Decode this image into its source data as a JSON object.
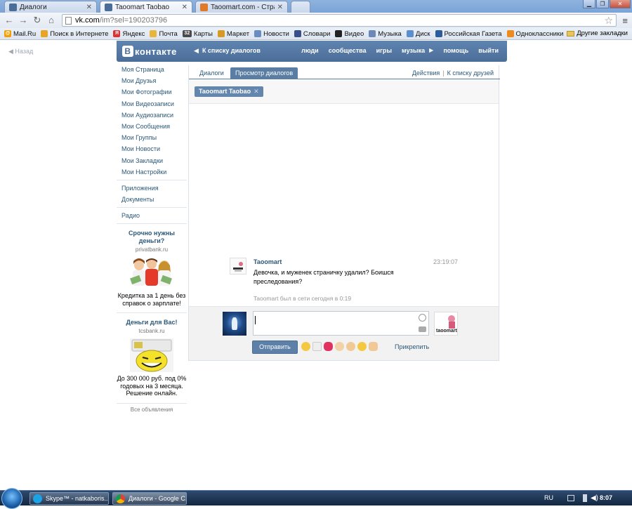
{
  "browser": {
    "tabs": [
      {
        "label": "Диалоги",
        "active": false
      },
      {
        "label": "Taoomart Taobao",
        "active": true
      },
      {
        "label": "Taoomart.com - Страниц",
        "active": false
      }
    ],
    "address_host": "vk.com",
    "address_path": "/im?sel=190203796",
    "bookmarks": [
      "Mail.Ru",
      "Поиск в Интернете",
      "Яндекс",
      "Почта",
      "Карты",
      "Маркет",
      "Новости",
      "Словари",
      "Видео",
      "Музыка",
      "Диск",
      "Российская Газета",
      "Одноклассники"
    ],
    "bookmark_badge": "32",
    "other_bookmarks": "Другие закладки"
  },
  "page": {
    "back": "Назад",
    "logo": "контакте",
    "logo_letter": "В",
    "header_back": "К списку диалогов",
    "nav": [
      "люди",
      "сообщества",
      "игры",
      "музыка",
      "помощь",
      "выйти"
    ]
  },
  "sidebar": {
    "main": [
      "Моя Страница",
      "Мои Друзья",
      "Мои Фотографии",
      "Мои Видеозаписи",
      "Мои Аудиозаписи",
      "Мои Сообщения",
      "Мои Группы",
      "Мои Новости",
      "Мои Закладки",
      "Мои Настройки"
    ],
    "extra": [
      "Приложения",
      "Документы"
    ],
    "radio": "Радио",
    "ads": [
      {
        "title": "Срочно нужны деньги?",
        "url": "privatbank.ru",
        "text": "Кредитка за 1 день без справок о зарплате!"
      },
      {
        "title": "Деньги для Вас!",
        "url": "tcsbank.ru",
        "text": "До 300 000 руб. под 0% годовых на 3 месяца. Решение онлайн."
      }
    ],
    "all_ads": "Все объявления"
  },
  "content": {
    "tab_dialogs": "Диалоги",
    "tab_view": "Просмотр диалогов",
    "actions": "Действия",
    "to_friends": "К списку друзей",
    "peer_chip": "Taoomart Taobao",
    "message": {
      "author": "Taoomart",
      "time": "23:19:07",
      "text": "Девочка, и муженек страничку удалил? Боишся преследования?",
      "status": "Taoomart был в сети сегодня в 0:19"
    },
    "send": "Отправить",
    "attach": "Прикрепить",
    "peer_logo": "taoomart"
  },
  "taskbar": {
    "items": [
      "Skype™ - natkaboris...",
      "Диалоги - Google C..."
    ],
    "lang": "RU",
    "clock": "8:07"
  }
}
